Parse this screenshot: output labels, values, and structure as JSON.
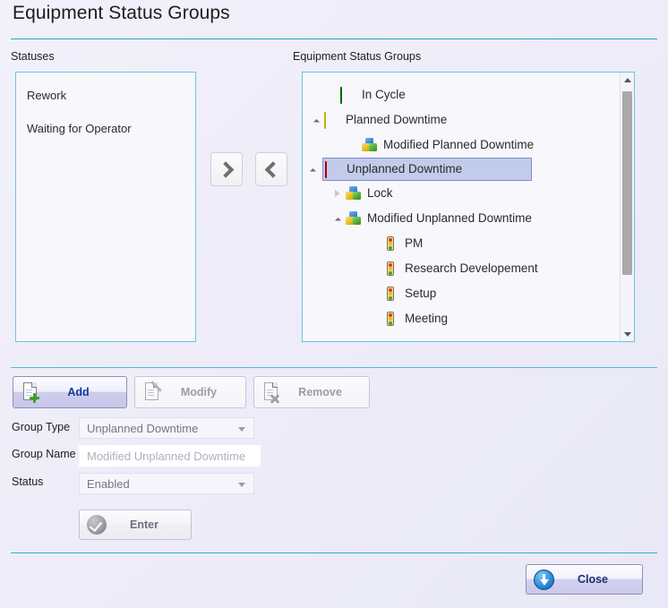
{
  "window": {
    "title": "Equipment Status Groups"
  },
  "panels": {
    "statuses_label": "Statuses",
    "groups_label": "Equipment Status Groups"
  },
  "statuses": {
    "items": [
      {
        "label": "Rework"
      },
      {
        "label": "Waiting for Operator"
      }
    ]
  },
  "transfer": {
    "move_right_icon": "chevron-right-icon",
    "move_left_icon": "chevron-left-icon"
  },
  "tree": {
    "nodes": [
      {
        "label": "In Cycle",
        "icon": "green-swatch-icon",
        "indent": 1,
        "expander": "none",
        "selected": false
      },
      {
        "label": "Planned Downtime",
        "icon": "yellow-swatch-icon",
        "indent": 1,
        "expander": "expanded",
        "selected": false
      },
      {
        "label": "Modified Planned Downtime",
        "icon": "cubes-icon",
        "indent": 2,
        "expander": "none",
        "selected": false
      },
      {
        "label": "Unplanned Downtime",
        "icon": "red-swatch-icon",
        "indent": 1,
        "expander": "expanded",
        "selected": true
      },
      {
        "label": "Lock",
        "icon": "cubes-icon",
        "indent": 2,
        "expander": "collapsed",
        "selected": false
      },
      {
        "label": "Modified Unplanned Downtime",
        "icon": "cubes-icon",
        "indent": 2,
        "expander": "expanded",
        "selected": false
      },
      {
        "label": "PM",
        "icon": "traffic-light-icon",
        "indent": 3,
        "expander": "none",
        "selected": false
      },
      {
        "label": "Research Developement",
        "icon": "traffic-light-icon",
        "indent": 3,
        "expander": "none",
        "selected": false
      },
      {
        "label": "Setup",
        "icon": "traffic-light-icon",
        "indent": 3,
        "expander": "none",
        "selected": false
      },
      {
        "label": "Meeting",
        "icon": "traffic-light-icon",
        "indent": 3,
        "expander": "none",
        "selected": false
      }
    ]
  },
  "toolbar": {
    "add_label": "Add",
    "add_icon": "document-add-icon",
    "modify_label": "Modify",
    "modify_icon": "document-edit-icon",
    "remove_label": "Remove",
    "remove_icon": "document-delete-icon"
  },
  "form": {
    "group_type_label": "Group Type",
    "group_type_value": "Unplanned Downtime",
    "group_name_label": "Group Name",
    "group_name_placeholder": "Modified Unplanned Downtime",
    "status_label": "Status",
    "status_value": "Enabled",
    "enter_label": "Enter",
    "enter_icon": "check-circle-icon"
  },
  "footer": {
    "close_label": "Close",
    "close_icon": "down-arrow-circle-icon"
  },
  "colors": {
    "accent_rule": "#3ba8c4",
    "in_cycle": "#00a000",
    "planned_downtime": "#ffff00",
    "unplanned_downtime": "#fe0000",
    "selection": "#c3cbeb",
    "primary_text": "#123a9a"
  }
}
